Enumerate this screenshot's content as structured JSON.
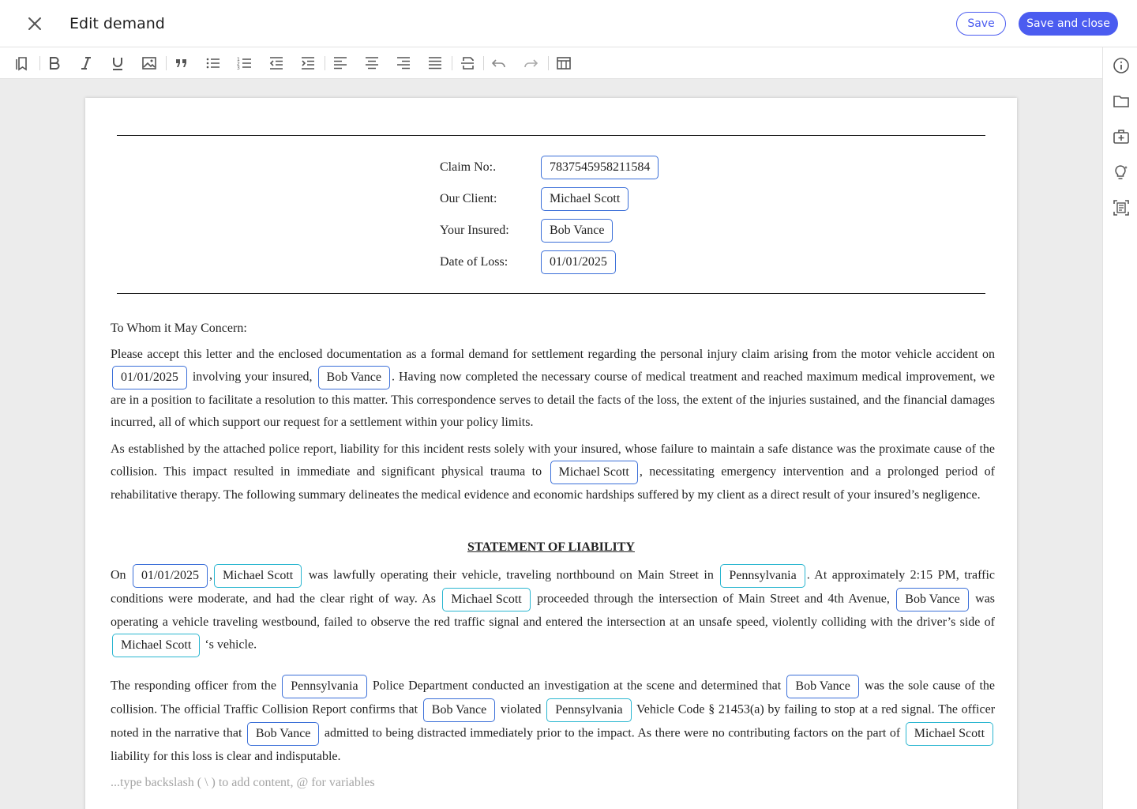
{
  "header": {
    "title": "Edit demand",
    "save_label": "Save",
    "save_close_label": "Save and close"
  },
  "toolbar": {
    "icons": [
      "bookmark-icon",
      "bold-icon",
      "italic-icon",
      "underline-icon",
      "image-icon",
      "quote-icon",
      "bullet-list-icon",
      "numbered-list-icon",
      "outdent-icon",
      "indent-icon",
      "align-left-icon",
      "align-center-icon",
      "align-right-icon",
      "align-justify-icon",
      "strikethrough-icon",
      "undo-icon",
      "redo-icon",
      "table-icon"
    ]
  },
  "rail": {
    "icons": [
      "info-icon",
      "folder-icon",
      "medical-kit-icon",
      "lightbulb-icon",
      "document-scan-icon"
    ]
  },
  "claim": {
    "claim_no_label": "Claim No:.",
    "claim_no": "7837545958211584",
    "client_label": "Our Client:",
    "client": "Michael Scott",
    "insured_label": "Your Insured:",
    "insured": "Bob Vance",
    "date_label": "Date of Loss:",
    "date": "01/01/2025"
  },
  "letter": {
    "salutation": "To Whom it May Concern:",
    "p1_a": "Please accept this letter and the enclosed documentation as a formal demand for settlement regarding the personal injury claim arising from the motor vehicle accident on",
    "p1_b": "involving your insured,",
    "p1_c": ". Having now completed the necessary course of medical treatment and reached maximum medical improvement, we are in a position to facilitate a resolution to this matter. This correspondence serves to detail the facts of the loss, the extent of the injuries sustained, and the financial damages incurred, all of which support our request for a settlement within your policy limits.",
    "p2_a": "As established by the attached police report, liability for this incident rests solely with your insured, whose failure to maintain a safe distance was the proximate cause of the collision. This impact resulted in immediate and significant physical trauma to",
    "p2_b": ", necessitating emergency intervention and a prolonged period of rehabilitative therapy. The following summary delineates the medical evidence and economic hardships suffered by my client as a direct result of your insured’s negligence.",
    "heading": "STATEMENT OF LIABILITY",
    "p3_a": "On",
    "p3_comma": ",",
    "p3_b": "was lawfully operating their vehicle, traveling northbound on Main Street in",
    "p3_c": ". At approximately 2:15 PM, traffic conditions were moderate, and had the clear right of way. As",
    "p3_d": "proceeded through the intersection of Main Street and 4th Avenue,",
    "p3_e": "was operating a vehicle traveling westbound, failed to observe the red traffic signal and entered the intersection at an unsafe speed, violently colliding with the driver’s side of",
    "p3_f": "‘s vehicle.",
    "p4_a": "The responding officer from the",
    "p4_b": "Police Department conducted an investigation at the scene and determined that",
    "p4_c": "was the sole cause of the collision. The official Traffic Collision Report confirms that",
    "p4_d": "violated",
    "p4_e": "Vehicle Code § 21453(a) by failing to stop at a red signal. The officer noted in the narrative that",
    "p4_f": "admitted to being distracted immediately prior to the impact. As there were no contributing factors on the part of",
    "p4_g": "liability for this loss is clear and indisputable.",
    "placeholder": "...type backslash ( \\ )  to add content,  @ for variables"
  },
  "variables": {
    "date": "01/01/2025",
    "client": "Michael Scott",
    "insured": "Bob Vance",
    "state": "Pennsylvania"
  },
  "colors": {
    "accent": "#4b5cf0",
    "chip_border": "#3b6fd8",
    "chip_border_alt": "#2ab6d0"
  }
}
